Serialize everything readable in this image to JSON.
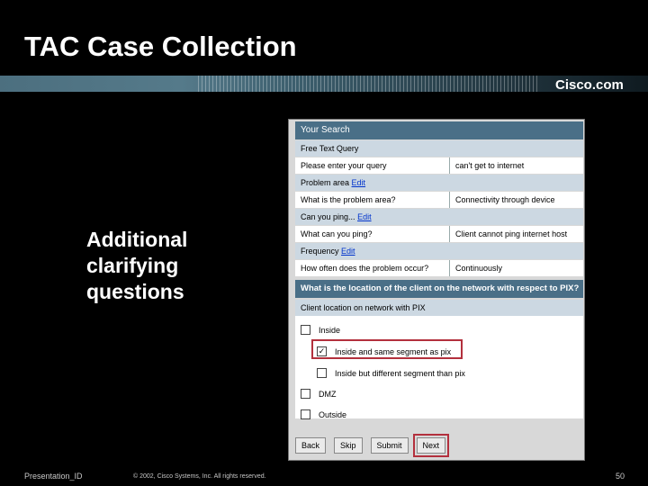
{
  "slide": {
    "title": "TAC Case Collection",
    "brand": "Cisco.com",
    "side_text": "Additional clarifying questions",
    "footer": {
      "left": "Presentation_ID",
      "middle": "© 2002, Cisco Systems, Inc. All rights reserved.",
      "page": "50"
    }
  },
  "panel": {
    "your_search": "Your Search",
    "free_text": "Free Text Query",
    "query_label": "Please enter your query",
    "query_value": "can't get to internet",
    "problem_area_prefix": "Problem area",
    "problem_area_edit": "Edit",
    "problem_area_q": "What is the problem area?",
    "problem_area_a": "Connectivity through device",
    "ping_prefix": "Can you ping...",
    "ping_edit": "Edit",
    "ping_q": "What can you ping?",
    "ping_a": "Client cannot ping internet host",
    "freq_prefix": "Frequency",
    "freq_edit": "Edit",
    "freq_q": "How often does the problem occur?",
    "freq_a": "Continuously",
    "question": "What is the location of the client on the network with respect to PIX?",
    "options_label": "Client location on network with PIX",
    "options": [
      {
        "label": "Inside",
        "checked": false
      },
      {
        "label": "Inside and same segment as pix",
        "checked": true
      },
      {
        "label": "Inside but different segment than pix",
        "checked": false
      },
      {
        "label": "DMZ",
        "checked": false
      },
      {
        "label": "Outside",
        "checked": false
      }
    ],
    "buttons": {
      "back": "Back",
      "skip": "Skip",
      "submit": "Submit",
      "next": "Next"
    },
    "colors": {
      "header": "#4a6f87",
      "highlight": "#b3303d",
      "link": "#0033cc"
    }
  }
}
